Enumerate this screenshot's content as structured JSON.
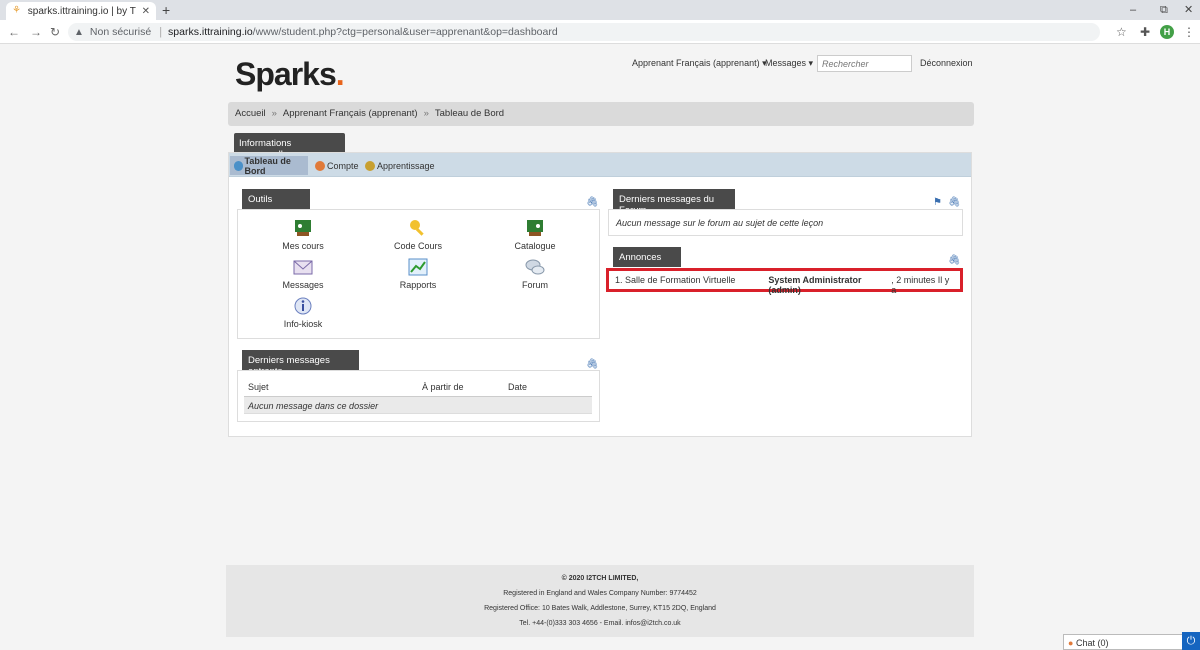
{
  "browser": {
    "tab_title": "sparks.ittraining.io | by The IT",
    "insecure_label": "Non sécurisé",
    "url_host": "sparks.ittraining.io",
    "url_path": "/www/student.php?ctg=personal&user=apprenant&op=dashboard",
    "profile_initial": "H"
  },
  "header": {
    "logo_text": "Sparks",
    "logo_dot": ".",
    "user_menu": "Apprenant Français (apprenant)",
    "messages_menu": "Messages",
    "search_placeholder": "Rechercher",
    "logout": "Déconnexion"
  },
  "breadcrumb": {
    "items": [
      "Accueil",
      "Apprenant Français (apprenant)",
      "Tableau de Bord"
    ],
    "separator": "»"
  },
  "personal_tab": "Informations personnelles",
  "subtabs": [
    "Tableau de Bord",
    "Compte",
    "Apprentissage"
  ],
  "tools_box": {
    "title": "Outils",
    "items": [
      "Mes cours",
      "Code Cours",
      "Catalogue",
      "Messages",
      "Rapports",
      "Forum",
      "Info-kiosk"
    ]
  },
  "inbox_box": {
    "title": "Derniers messages entrants",
    "columns": [
      "Sujet",
      "À partir de",
      "Date"
    ],
    "empty": "Aucun message dans ce dossier"
  },
  "forum_box": {
    "title": "Derniers messages du Forum",
    "empty": "Aucun message sur le forum au sujet de cette leçon"
  },
  "annonces_box": {
    "title": "Annonces",
    "items": [
      {
        "title": "1. Salle de Formation Virtuelle",
        "author": "System Administrator (admin)",
        "time": ", 2 minutes Il y a"
      }
    ]
  },
  "footer": {
    "line1": "© 2020 I2TCH LIMITED,",
    "line2": "Registered in England and Wales Company Number: 9774452",
    "line3": "Registered Office: 10 Bates Walk, Addlestone, Surrey, KT15 2DQ, England",
    "line4": "Tel. +44-(0)333 303 4656 - Email. infos@i2tch.co.uk"
  },
  "chat": "Chat (0)",
  "colors": {
    "accent": "#e8641b",
    "dark_tab": "#4a4a4a",
    "highlight": "#d9202a",
    "subtab_bar": "#cddbe6"
  }
}
